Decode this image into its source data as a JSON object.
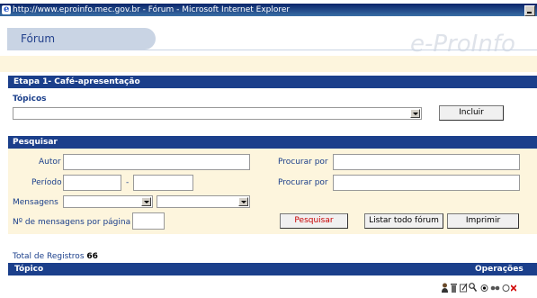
{
  "window": {
    "title": "http://www.eproinfo.mec.gov.br - Fórum - Microsoft Internet Explorer"
  },
  "header": {
    "tab_label": "Fórum",
    "brand": "e-ProInfo"
  },
  "etapa": {
    "title": "Etapa 1- Café-apresentação",
    "topicos_label": "Tópicos",
    "topicos_selected": "",
    "incluir_label": "Incluir"
  },
  "search": {
    "section_title": "Pesquisar",
    "autor_label": "Autor",
    "autor_value": "",
    "periodo_label": "Período",
    "periodo_dash": "-",
    "mensagens_label": "Mensagens",
    "procurar_label_1": "Procurar por",
    "procurar_label_2": "Procurar por",
    "msgs_per_page_label": "Nº de mensagens por página",
    "pesquisar_label": "Pesquisar",
    "listar_label": "Listar todo fórum",
    "imprimir_label": "Imprimir"
  },
  "results": {
    "total_label": "Total de Registros",
    "total_value": "66",
    "col_topico": "Tópico",
    "col_operacoes": "Operações"
  },
  "colors": {
    "bar_blue": "#1b3f8b",
    "cream": "#fdf5dd",
    "tab": "#c9d4e4",
    "search_button_text": "#c80000"
  },
  "icons": [
    "user-icon",
    "delete-icon",
    "edit-icon",
    "search-icon",
    "radio-selected-icon",
    "glasses-icon",
    "radio-icon",
    "close-icon"
  ]
}
